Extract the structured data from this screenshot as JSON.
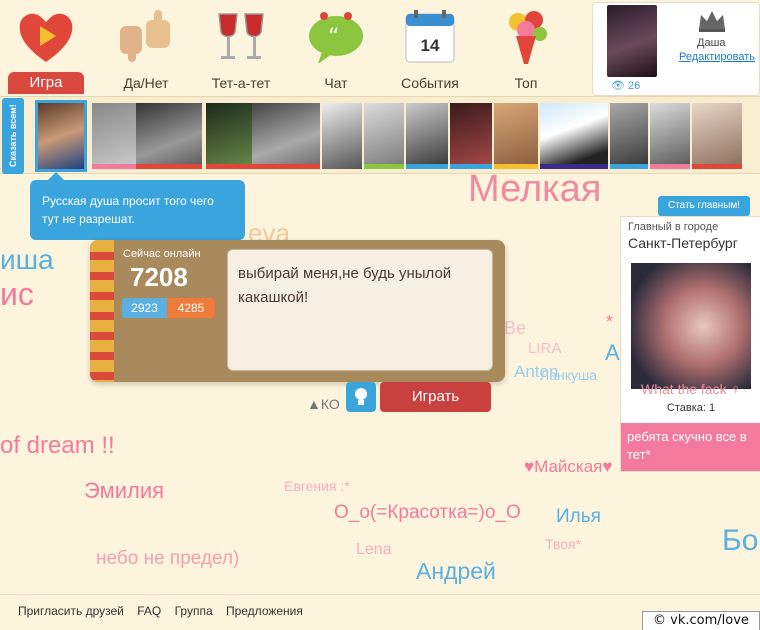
{
  "nav": {
    "items": [
      {
        "label": "Игра",
        "icon": "heart-play-icon",
        "active": true
      },
      {
        "label": "Да/Нет",
        "icon": "thumbs-icon"
      },
      {
        "label": "Тет-а-тет",
        "icon": "wine-glasses-icon"
      },
      {
        "label": "Чат",
        "icon": "chat-bubble-icon"
      },
      {
        "label": "События",
        "icon": "calendar-icon"
      },
      {
        "label": "Топ",
        "icon": "bouquet-icon"
      }
    ],
    "calendar_day": "14"
  },
  "profile": {
    "name": "Даша",
    "edit_label": "Редактировать",
    "views": "26"
  },
  "strip": {
    "say_all_label": "Сказать всем!"
  },
  "tooltip": {
    "text": "Русская душа просит того чего тут не разрешат."
  },
  "cloud": {
    "words": [
      "Мелкая",
      "eva",
      "иша",
      "ис",
      "of dream !!",
      "Эмилия",
      "Евгения :*",
      "О_о(=Красотка=)о_О",
      "Илья",
      "небо не предел)",
      "Lena",
      "Твоя*",
      "Андрей",
      "Бо",
      "♥Майская♥",
      "Be",
      "LIRA",
      "Anton",
      "Ланкуша",
      "A",
      "*",
      "▲КО"
    ]
  },
  "card": {
    "online_label": "Сейчас онлайн",
    "online_count": "7208",
    "count_a": "2923",
    "count_b": "4285",
    "status_text": "выбирай меня,не будь унылой какашкой!",
    "play_label": "Играть"
  },
  "main_panel": {
    "button_label": "Стать главным!",
    "label": "Главный в городе",
    "city": "Санкт-Петербург",
    "name": "What the fack ♀",
    "bet": "Ставка: 1",
    "message": "ребята скучно все в тет*"
  },
  "footer": {
    "links": [
      "Пригласить друзей",
      "FAQ",
      "Группа",
      "Предложения"
    ],
    "badge": "© vk.com/love"
  },
  "colors": {
    "accent_blue": "#3aa4dc",
    "accent_red": "#c9413f",
    "pink": "#f37a9c",
    "bg": "#fdf4dd"
  }
}
